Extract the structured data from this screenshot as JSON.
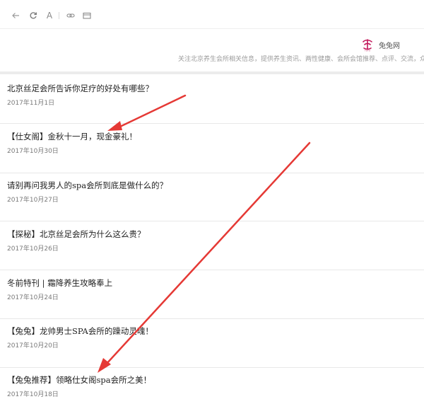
{
  "toolbar": {
    "back_icon": "arrow-left-icon",
    "refresh_icon": "refresh-icon",
    "font_label": "A",
    "link_icon": "link-icon",
    "card_icon": "card-icon"
  },
  "header": {
    "site_name": "兔兔网",
    "tagline": "关注北京养生会所相关信息，提供养生资讯、两性健康、会所会馆推荐、点评、交流，众多信息"
  },
  "articles": [
    {
      "title": "北京丝足会所告诉你足疗的好处有哪些？",
      "date": "2017年11月1日"
    },
    {
      "title": "【仕女阁】金秋十一月，现金豪礼！",
      "date": "2017年10月30日"
    },
    {
      "title": "请别再问我男人的spa会所到底是做什么的？",
      "date": "2017年10月27日"
    },
    {
      "title": "【探秘】北京丝足会所为什么这么贵？",
      "date": "2017年10月26日"
    },
    {
      "title": "冬前特刊 | 霜降养生攻略奉上",
      "date": "2017年10月24日"
    },
    {
      "title": "【兔兔】龙帅男士SPA会所的躁动灵魂！",
      "date": "2017年10月20日"
    },
    {
      "title": "【兔兔推荐】领略仕女阁spa会所之美！",
      "date": "2017年10月18日"
    }
  ],
  "colors": {
    "arrow": "#e53935",
    "logo": "#c2185b"
  }
}
